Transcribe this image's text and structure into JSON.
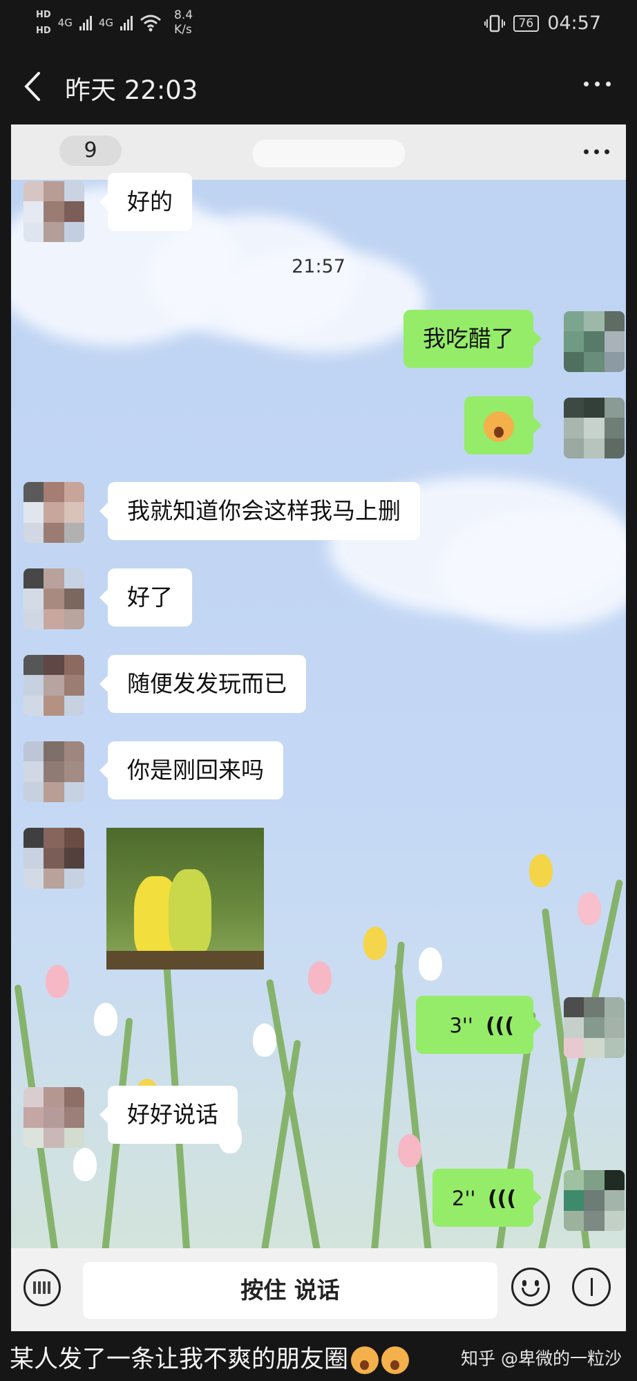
{
  "status_bar": {
    "hd1": "HD",
    "hd2": "HD",
    "net1": "4G",
    "net2": "4G",
    "speed_value": "8.4",
    "speed_unit": "K/s",
    "battery": "76",
    "time": "04:57"
  },
  "header": {
    "title": "昨天 22:03"
  },
  "inner_chat": {
    "unread_badge": "9",
    "timestamp": "21:57",
    "messages": [
      {
        "side": "in",
        "text": "好的"
      },
      {
        "side": "out",
        "text": "我吃醋了"
      },
      {
        "side": "out",
        "type": "emoji",
        "icon": "hushed-face-emoji"
      },
      {
        "side": "in",
        "text": "我就知道你会这样我马上删"
      },
      {
        "side": "in",
        "text": "好了"
      },
      {
        "side": "in",
        "text": "随便发发玩而已"
      },
      {
        "side": "in",
        "text": "你是刚回来吗"
      },
      {
        "side": "in",
        "type": "sticker",
        "icon": "teletubbies-sticker"
      },
      {
        "side": "out",
        "type": "voice",
        "duration": "3''"
      },
      {
        "side": "in",
        "text": "好好说话"
      },
      {
        "side": "out",
        "type": "voice",
        "duration": "2''"
      }
    ],
    "hold_to_talk": "按住 说话"
  },
  "caption": {
    "text": "某人发了一条让我不爽的朋友圈",
    "watermark": "知乎 @卑微的一粒沙"
  },
  "colors": {
    "bubble_out": "#95ec69",
    "bubble_in": "#ffffff",
    "chat_bg": "#c4d8f5",
    "bar_bg": "#161616"
  }
}
